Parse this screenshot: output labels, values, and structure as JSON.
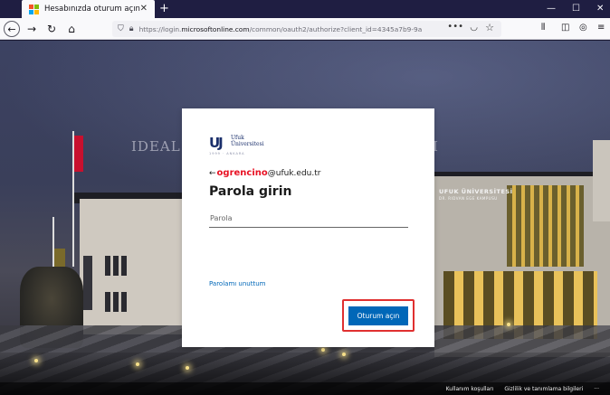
{
  "browser": {
    "tab_title": "Hesabınızda oturum açın",
    "tab_close": "✕",
    "new_tab": "+",
    "url_prefix": "https://login.",
    "url_domain": "microsoftonline.com",
    "url_path": "/common/oauth2/authorize?client_id=4345a7b9-9a",
    "url_more": "•••",
    "window_min": "—",
    "window_max": "☐",
    "window_close": "✕",
    "favicon_colors": [
      "#f35325",
      "#81bc06",
      "#05a6f0",
      "#ffba08"
    ]
  },
  "background": {
    "left_text": "IDEAL",
    "right_text": "I",
    "campus_name": "UFUK ÜNİVERSİTESİ",
    "campus_sub": "DR. RIDVAN EGE KAMPUSU"
  },
  "card": {
    "logo_mark": "UJ",
    "logo_line1": "Ufuk",
    "logo_line2": "Üniversitesi",
    "logo_sub": "1999 · ANKARA",
    "back_arrow": "←",
    "username_redacted": "ogrencino",
    "email_domain": "@ufuk.edu.tr",
    "title": "Parola girin",
    "password_placeholder": "Parola",
    "forgot_link": "Parolamı unuttum",
    "signin_button": "Oturum açın"
  },
  "footer": {
    "terms": "Kullanım koşulları",
    "privacy": "Gizlilik ve tanımlama bilgileri",
    "more": "···"
  },
  "colors": {
    "accent": "#0067b8",
    "highlight": "#e03030",
    "brand": "#1a2f6b"
  }
}
